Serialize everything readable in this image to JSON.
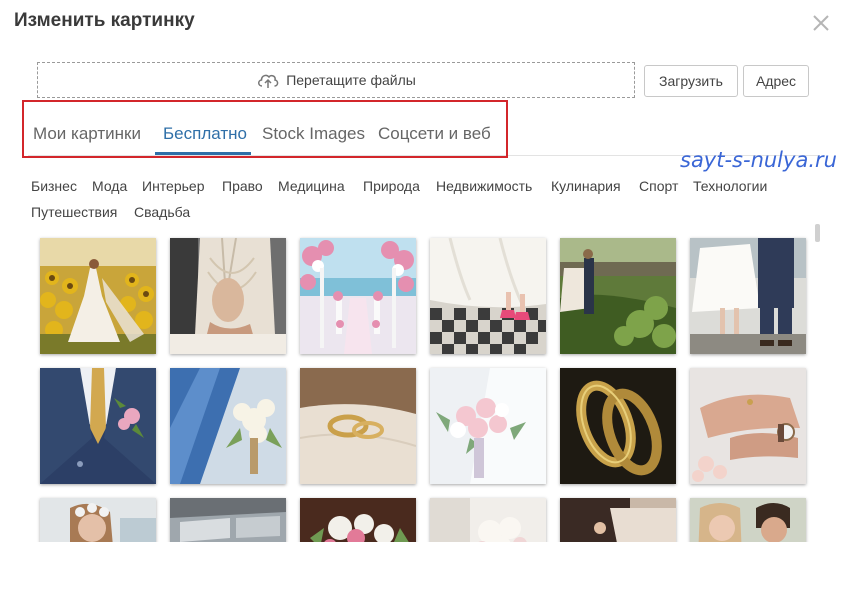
{
  "dialog": {
    "title": "Изменить картинку"
  },
  "upload": {
    "dropzone_label": "Перетащите файлы",
    "upload_button": "Загрузить",
    "url_button": "Адрес"
  },
  "tabs": [
    {
      "label": "Мои картинки",
      "active": false
    },
    {
      "label": "Бесплатно",
      "active": true
    },
    {
      "label": "Stock Images",
      "active": false
    },
    {
      "label": "Соцсети и веб",
      "active": false
    }
  ],
  "watermark": "sayt-s-nulya.ru",
  "categories": [
    "Бизнес",
    "Мода",
    "Интерьер",
    "Право",
    "Медицина",
    "Природа",
    "Недвижимость",
    "Кулинария",
    "Спорт",
    "Технологии",
    "Путешествия",
    "Свадьба"
  ],
  "colors": {
    "accent": "#2f6fa8",
    "highlight": "#d3262b",
    "watermark": "#3a66d6"
  },
  "thumbnails": [
    {
      "name": "bride-in-sunflower-field"
    },
    {
      "name": "bride-back-lace-dress"
    },
    {
      "name": "wedding-arch-flowers"
    },
    {
      "name": "bride-pink-sneakers"
    },
    {
      "name": "couple-in-garden"
    },
    {
      "name": "couple-legs-sitting"
    },
    {
      "name": "groom-suit-boutonniere"
    },
    {
      "name": "bouquet-blue-suit"
    },
    {
      "name": "wedding-rings-on-table"
    },
    {
      "name": "bride-holding-bouquet"
    },
    {
      "name": "gold-wedding-rings-closeup"
    },
    {
      "name": "hands-with-ring"
    },
    {
      "name": "bride-with-flower-crown"
    },
    {
      "name": "wedding-car"
    },
    {
      "name": "flower-arrangement"
    },
    {
      "name": "white-bouquet"
    },
    {
      "name": "couple-hands"
    },
    {
      "name": "smiling-couple"
    }
  ]
}
